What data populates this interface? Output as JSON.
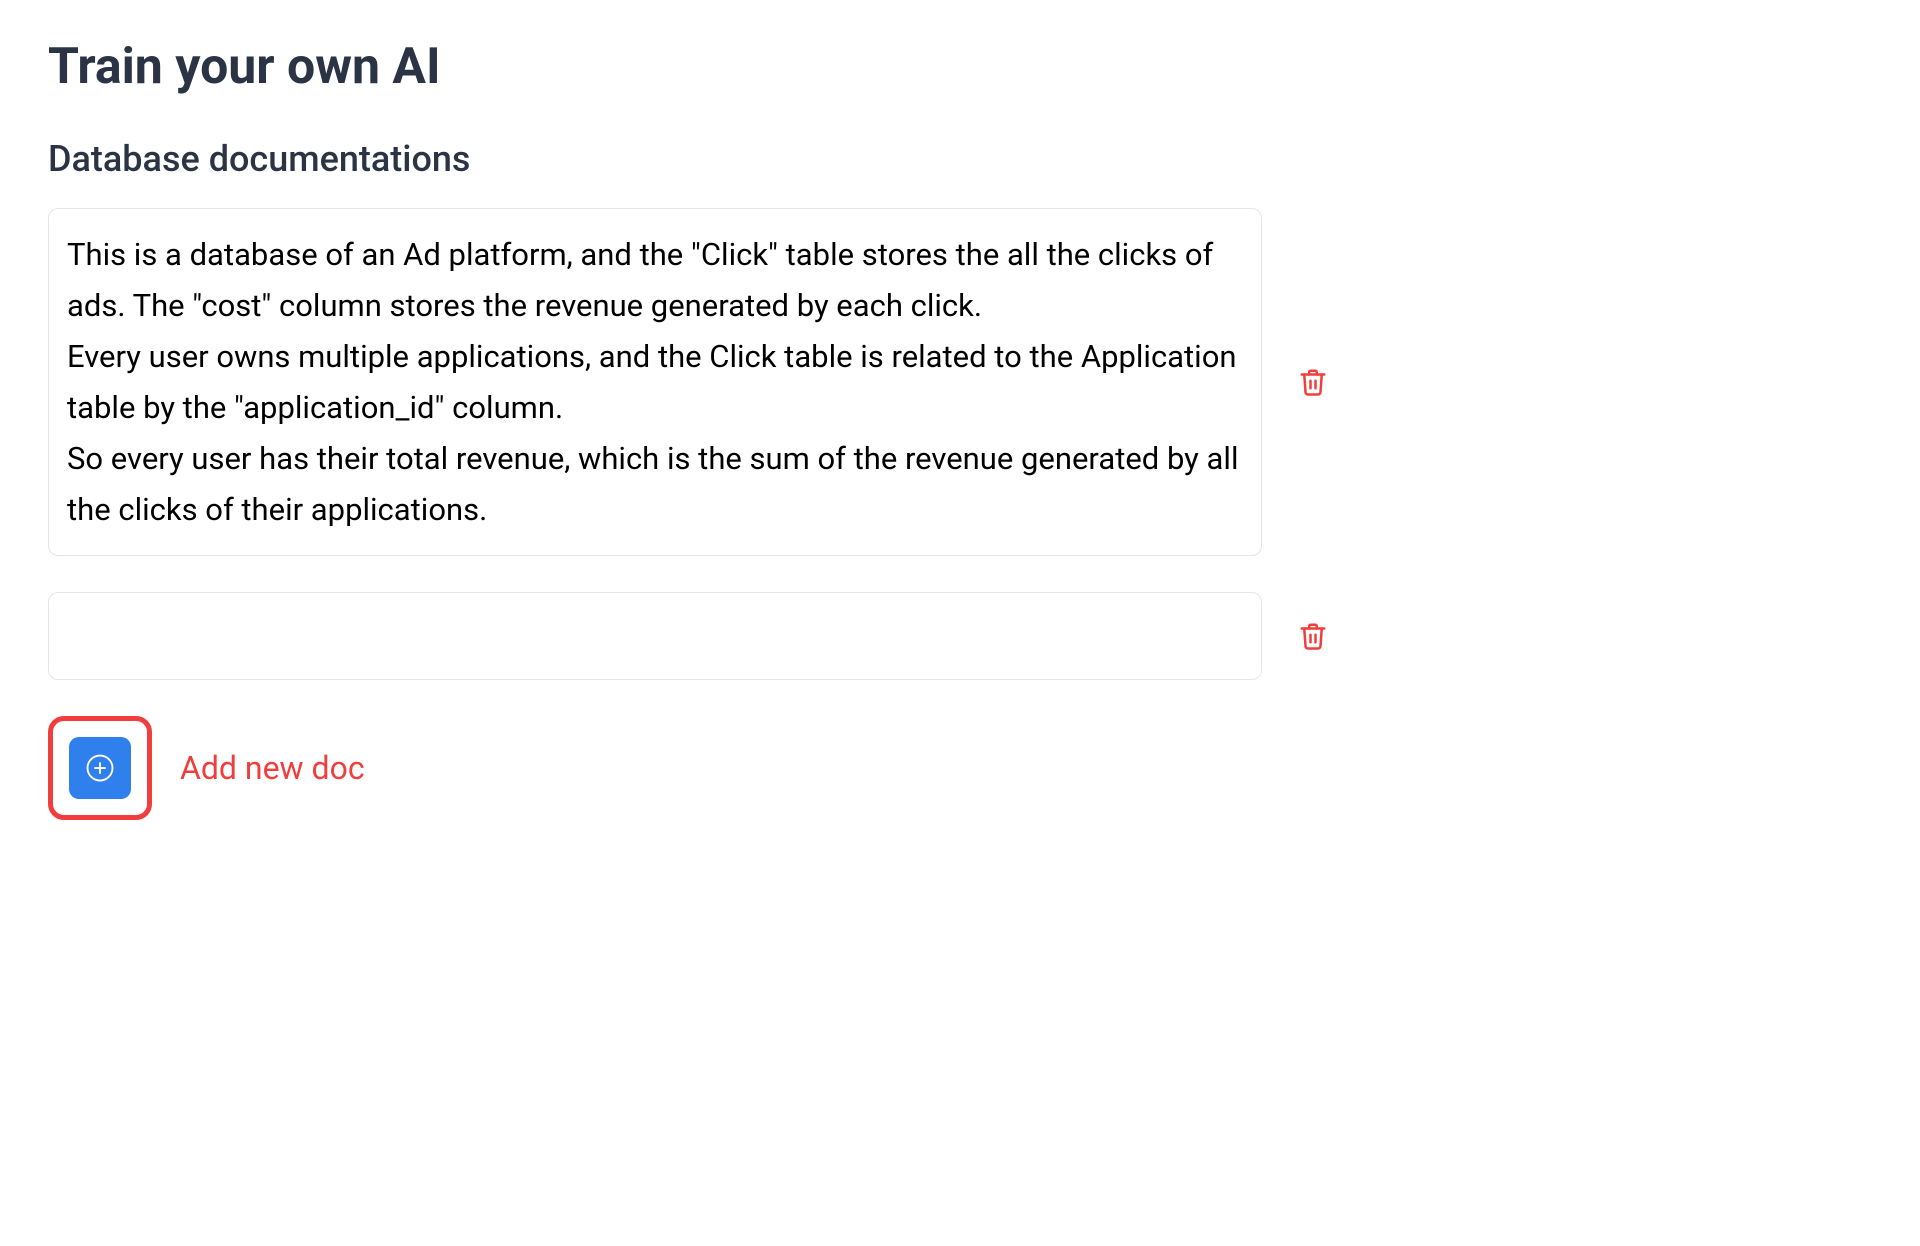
{
  "header": {
    "title": "Train your own AI",
    "subtitle": "Database documentations"
  },
  "docs": [
    {
      "text": "This is a database of an Ad platform, and the \"Click\" table stores the all the clicks of ads. The \"cost\" column stores the revenue generated by each click.\nEvery user owns multiple applications, and the Click table is related to the Application table by the \"application_id\" column.\nSo every user has their total revenue, which is the sum of the revenue generated by all the clicks of their applications."
    },
    {
      "text": ""
    }
  ],
  "actions": {
    "add_label": "Add new doc"
  },
  "icons": {
    "trash": "trash-icon",
    "plus": "plus-circle-icon"
  },
  "colors": {
    "highlight": "#f03e3e",
    "primary_button": "#2f80ed",
    "heading": "#2b3445"
  }
}
